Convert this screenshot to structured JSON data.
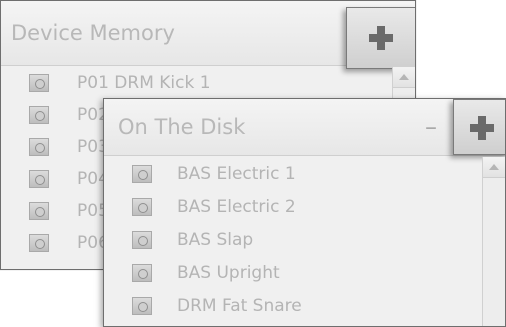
{
  "device_memory": {
    "title": "Device Memory",
    "items": [
      {
        "label": "P01 DRM Kick 1"
      },
      {
        "label": "P02"
      },
      {
        "label": "P03"
      },
      {
        "label": "P04"
      },
      {
        "label": "P05"
      },
      {
        "label": "P06"
      }
    ]
  },
  "on_the_disk": {
    "title": "On The Disk",
    "items": [
      {
        "label": "BAS Electric 1"
      },
      {
        "label": "BAS Electric 2"
      },
      {
        "label": "BAS Slap"
      },
      {
        "label": "BAS Upright"
      },
      {
        "label": "DRM Fat Snare"
      }
    ]
  },
  "icons": {
    "add": "plus-icon",
    "remove": "minus-icon",
    "item": "sound-file-icon",
    "scroll_up": "chevron-up-icon"
  }
}
